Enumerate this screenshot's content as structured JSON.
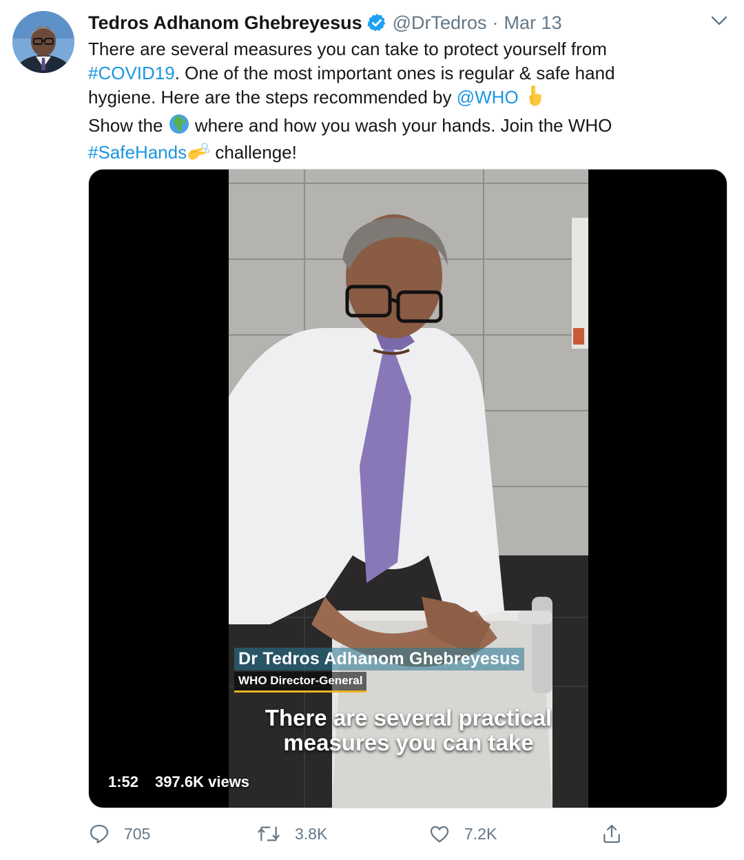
{
  "tweet": {
    "author_name": "Tedros Adhanom Ghebreyesus",
    "handle": "@DrTedros",
    "separator": "·",
    "date": "Mar 13",
    "text": {
      "l1": "There are several measures you can take to protect yourself from",
      "l2_link": "#COVID19",
      "l2_rest": ". One of the most important ones is regular & safe hand",
      "l3_text": "hygiene. Here are the steps recommended by ",
      "l3_link": "@WHO",
      "l4_a": "Show the ",
      "l4_b": " where and how you wash your hands. Join the WHO",
      "l5_link": "#SafeHands",
      "l5_rest": " challenge!"
    },
    "emoji": {
      "pointing_down": "backhand-index-pointing-down-icon",
      "globe": "globe-africa-icon",
      "hands": "washing-hands-icon"
    }
  },
  "media": {
    "lower_third_name": "Dr Tedros Adhanom Ghebreyesus",
    "lower_third_title": "WHO Director-General",
    "subtitle_l1": "There are several practical",
    "subtitle_l2": "measures you can take",
    "duration": "1:52",
    "views": "397.6K views"
  },
  "actions": {
    "reply_count": "705",
    "retweet_count": "3.8K",
    "like_count": "7.2K"
  },
  "colors": {
    "link": "#1b95e0",
    "muted": "#657786",
    "verified": "#1da1f2"
  }
}
